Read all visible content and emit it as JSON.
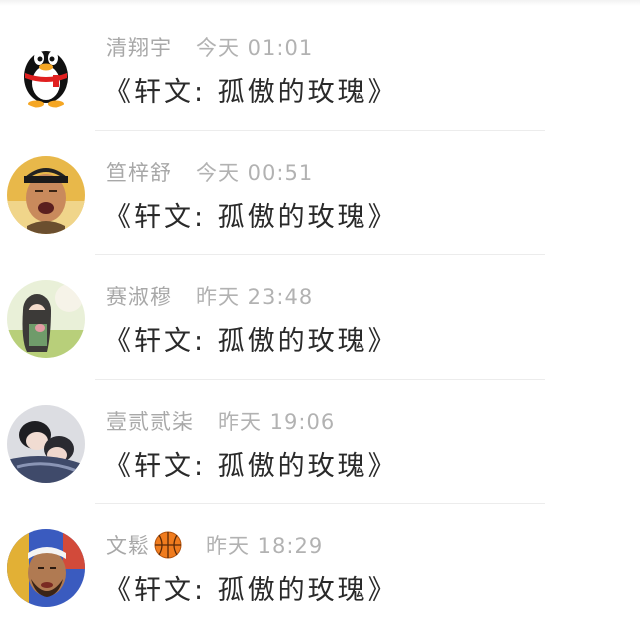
{
  "messages": [
    {
      "sender": "清翔宇",
      "time": "今天 01:01",
      "text": "《轩文: 孤傲的玫瑰》",
      "avatar_icon": "qq-penguin-avatar"
    },
    {
      "sender": "笪梓舒",
      "time": "今天 00:51",
      "text": "《轩文: 孤傲的玫瑰》",
      "avatar_icon": "person-photo-avatar"
    },
    {
      "sender": "赛淑穆",
      "time": "昨天 23:48",
      "text": "《轩文: 孤傲的玫瑰》",
      "avatar_icon": "anime-girl-avatar"
    },
    {
      "sender": "壹贰贰柒",
      "time": "昨天 19:06",
      "text": "《轩文: 孤傲的玫瑰》",
      "avatar_icon": "sleeping-couple-avatar"
    },
    {
      "sender": "文鬆",
      "time": "昨天 18:29",
      "text": "《轩文: 孤傲的玫瑰》",
      "avatar_icon": "basketball-player-avatar",
      "name_emoji": "basketball-icon"
    }
  ],
  "colors": {
    "meta_text": "#a8a8a8",
    "message_text": "#2a2a2a",
    "divider": "#ececec",
    "basketball": "#f07c1e"
  }
}
